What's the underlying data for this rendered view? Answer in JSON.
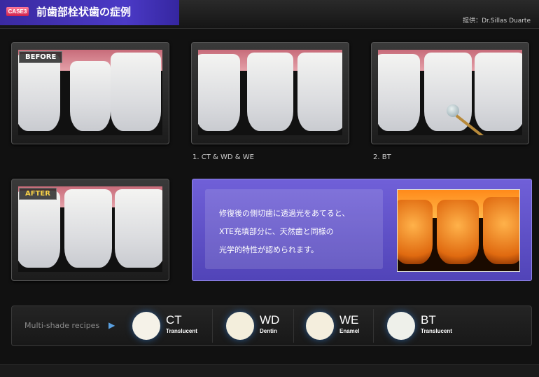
{
  "header": {
    "case_badge": "CASE3",
    "title": "前歯部栓状歯の症例",
    "credit": "提供：Dr.Sillas Duarte"
  },
  "photos": {
    "before_label": "BEFORE",
    "after_label": "AFTER",
    "step1_caption": "1. CT & WD & WE",
    "step2_caption": "2. BT"
  },
  "notice": {
    "line1": "修復後の側切歯に透過光をあてると、",
    "line2": "XTE充填部分に、天然歯と同様の",
    "line3": "光学的特性が認められます。"
  },
  "recipes": {
    "label": "Multi-shade recipes",
    "arrow_icon": "arrow-right-icon",
    "shades": [
      {
        "code": "CT",
        "sub": "Translucent",
        "color": "#f5f2e8"
      },
      {
        "code": "WD",
        "sub": "Dentin",
        "color": "#f3eedc"
      },
      {
        "code": "WE",
        "sub": "Enamel",
        "color": "#f4eedd"
      },
      {
        "code": "BT",
        "sub": "Translucent",
        "color": "#eef0ea"
      }
    ]
  }
}
